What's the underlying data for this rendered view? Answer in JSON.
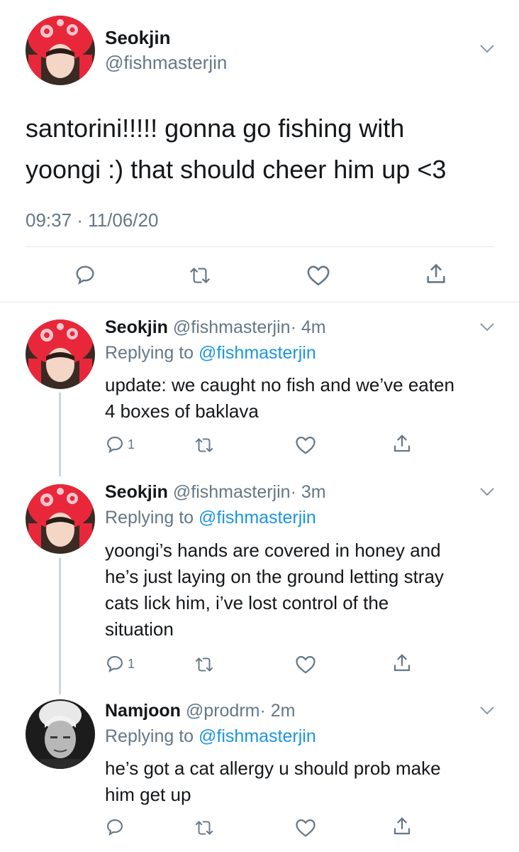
{
  "main_tweet": {
    "display_name": "Seokjin",
    "handle": "@fishmasterjin",
    "text_line1": "santorini!!!!! gonna go fishing with",
    "text_line2": "yoongi :) that should cheer him up <3",
    "timestamp": "09:37 · 11/06/20"
  },
  "replies": [
    {
      "display_name": "Seokjin",
      "handle": "@fishmasterjin",
      "time": "· 4m",
      "replying_to_prefix": "Replying to",
      "replying_to_handle": "@fishmasterjin",
      "text_lines": [
        "update: we caught no fish and we’ve eaten",
        "4 boxes of baklava"
      ],
      "reply_count": "1"
    },
    {
      "display_name": "Seokjin",
      "handle": "@fishmasterjin",
      "time": "· 3m",
      "replying_to_prefix": "Replying to",
      "replying_to_handle": "@fishmasterjin",
      "text_lines": [
        "yoongi’s hands are covered in honey and",
        "he’s just laying on the ground letting stray",
        "cats lick him, i’ve lost control of the",
        "situation"
      ],
      "reply_count": "1"
    },
    {
      "display_name": "Namjoon",
      "handle": "@prodrm",
      "time": "· 2m",
      "replying_to_prefix": "Replying to",
      "replying_to_handle": "@fishmasterjin",
      "text_lines": [
        "he’s got a cat allergy u should prob make",
        "him get up"
      ],
      "reply_count": ""
    }
  ],
  "colors": {
    "link": "#1b95e0",
    "muted": "#657786",
    "divider": "#e1e8ed",
    "thread": "#ccd6dd"
  },
  "icons": [
    "reply-icon",
    "retweet-icon",
    "like-icon",
    "share-icon",
    "chevron-down-icon"
  ]
}
